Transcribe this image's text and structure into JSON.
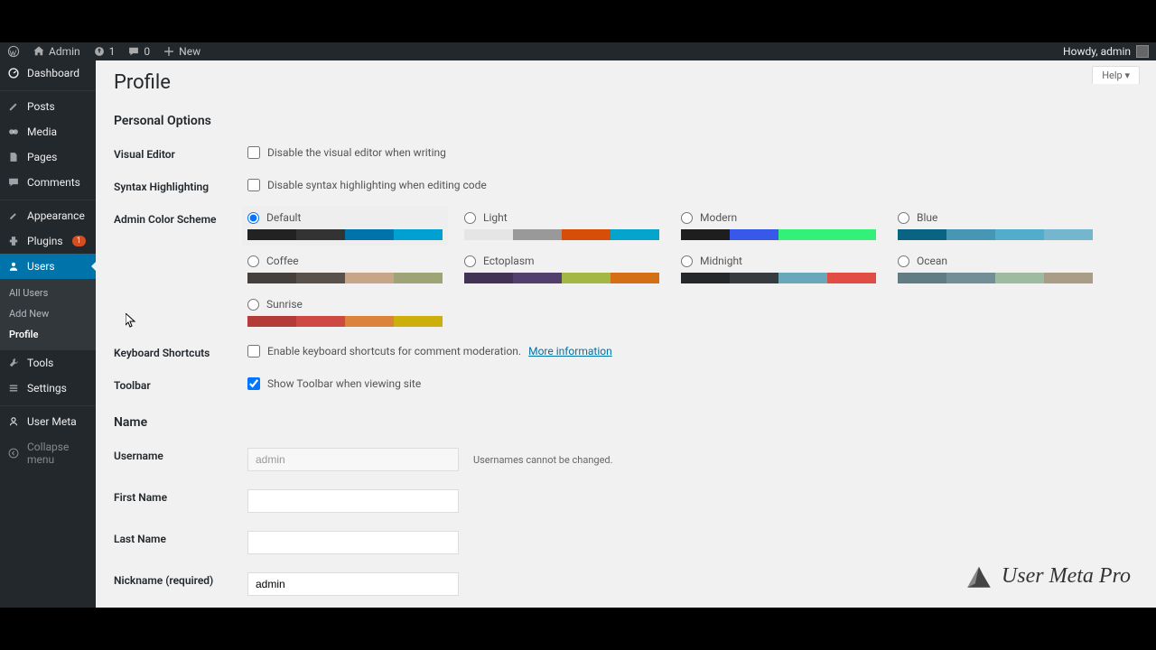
{
  "adminbar": {
    "site_name": "Admin",
    "updates": "1",
    "comments": "0",
    "new": "New",
    "howdy": "Howdy, admin"
  },
  "sidebar": {
    "dashboard": "Dashboard",
    "posts": "Posts",
    "media": "Media",
    "pages": "Pages",
    "comments": "Comments",
    "appearance": "Appearance",
    "plugins": "Plugins",
    "plugins_badge": "1",
    "users": "Users",
    "users_sub": {
      "all": "All Users",
      "add": "Add New",
      "profile": "Profile"
    },
    "tools": "Tools",
    "settings": "Settings",
    "user_meta": "User Meta",
    "collapse": "Collapse menu"
  },
  "page": {
    "help": "Help ▾",
    "title": "Profile",
    "section_personal": "Personal Options",
    "visual_editor_label": "Visual Editor",
    "visual_editor_check": "Disable the visual editor when writing",
    "syntax_label": "Syntax Highlighting",
    "syntax_check": "Disable syntax highlighting when editing code",
    "scheme_label": "Admin Color Scheme",
    "keyboard_label": "Keyboard Shortcuts",
    "keyboard_check": "Enable keyboard shortcuts for comment moderation.",
    "keyboard_link": "More information",
    "toolbar_label": "Toolbar",
    "toolbar_check": "Show Toolbar when viewing site",
    "section_name": "Name",
    "username_label": "Username",
    "username_value": "admin",
    "username_desc": "Usernames cannot be changed.",
    "firstname_label": "First Name",
    "lastname_label": "Last Name",
    "nickname_label": "Nickname (required)",
    "nickname_value": "admin"
  },
  "schemes": [
    {
      "name": "Default",
      "selected": true,
      "colors": [
        "#222",
        "#333",
        "#0073aa",
        "#00a0d2"
      ]
    },
    {
      "name": "Light",
      "colors": [
        "#e5e5e5",
        "#999",
        "#d64e07",
        "#04a4cc"
      ]
    },
    {
      "name": "Modern",
      "colors": [
        "#1e1e1e",
        "#3858e9",
        "#33f078",
        "#33f078"
      ]
    },
    {
      "name": "Blue",
      "colors": [
        "#096484",
        "#4796b3",
        "#52accc",
        "#74B6CE"
      ]
    },
    {
      "name": "Coffee",
      "colors": [
        "#46403c",
        "#59524c",
        "#c7a589",
        "#9ea476"
      ]
    },
    {
      "name": "Ectoplasm",
      "colors": [
        "#413256",
        "#523f6d",
        "#a3b745",
        "#d46f15"
      ]
    },
    {
      "name": "Midnight",
      "colors": [
        "#25282b",
        "#363b3f",
        "#69a8bb",
        "#e14d43"
      ]
    },
    {
      "name": "Ocean",
      "colors": [
        "#627c83",
        "#738e96",
        "#9ebaa0",
        "#aa9d88"
      ]
    },
    {
      "name": "Sunrise",
      "colors": [
        "#b43c38",
        "#cf4944",
        "#dd823b",
        "#ccaf0b"
      ]
    }
  ],
  "watermark": "User Meta Pro"
}
